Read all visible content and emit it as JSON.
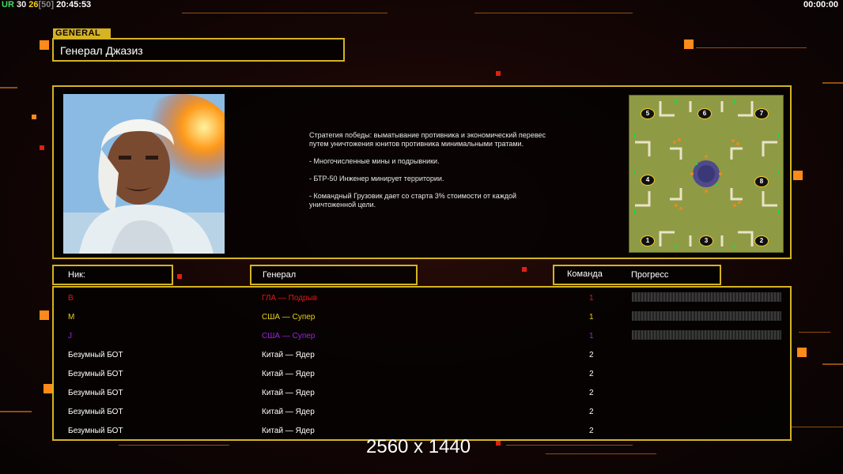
{
  "hud": {
    "left": [
      {
        "text": "UR",
        "cls": "ur"
      },
      {
        "text": "30",
        "cls": "n1"
      },
      {
        "text": "26",
        "cls": "n2"
      },
      {
        "text": "[50]",
        "cls": "n3"
      },
      {
        "text": "20:45:53",
        "cls": "time"
      }
    ],
    "right": "00:00:00"
  },
  "general": {
    "tag": "GENERAL",
    "name": "Генерал Джазиз",
    "description": [
      "Стратегия победы: выматывание противника и экономический перевес путем уничтожения юнитов противника минимальными тратами.",
      "- Многочисленные мины и подрывники.",
      "- БТР-50 Инженер минирует территории.",
      "- Командный Грузовик дает со старта 3% стоимости от каждой уничтоженной цели."
    ]
  },
  "minimap": {
    "start_positions": [
      "1",
      "2",
      "3",
      "4",
      "5",
      "6",
      "7",
      "8"
    ]
  },
  "table": {
    "headers": {
      "nick": "Ник:",
      "general": "Генерал",
      "team": "Команда",
      "progress": "Прогресс"
    },
    "rows": [
      {
        "nick": "B",
        "general": "ГЛА — Подрыв",
        "team": "1",
        "color": "#e01818",
        "progress": 0
      },
      {
        "nick": "M",
        "general": "США — Супер",
        "team": "1",
        "color": "#e6d21a",
        "progress": 0
      },
      {
        "nick": "J",
        "general": "США — Супер",
        "team": "1",
        "color": "#a020e8",
        "progress": 0
      },
      {
        "nick": "Безумный БОТ",
        "general": "Китай — Ядер",
        "team": "2",
        "color": "#ffffff",
        "progress": null
      },
      {
        "nick": "Безумный БОТ",
        "general": "Китай — Ядер",
        "team": "2",
        "color": "#ffffff",
        "progress": null
      },
      {
        "nick": "Безумный БОТ",
        "general": "Китай — Ядер",
        "team": "2",
        "color": "#ffffff",
        "progress": null
      },
      {
        "nick": "Безумный БОТ",
        "general": "Китай — Ядер",
        "team": "2",
        "color": "#ffffff",
        "progress": null
      },
      {
        "nick": "Безумный БОТ",
        "general": "Китай — Ядер",
        "team": "2",
        "color": "#ffffff",
        "progress": null
      }
    ]
  },
  "resolution_text": "2560 x 1440",
  "colors": {
    "frame": "#d5b322",
    "accent": "#ff8a1a"
  }
}
